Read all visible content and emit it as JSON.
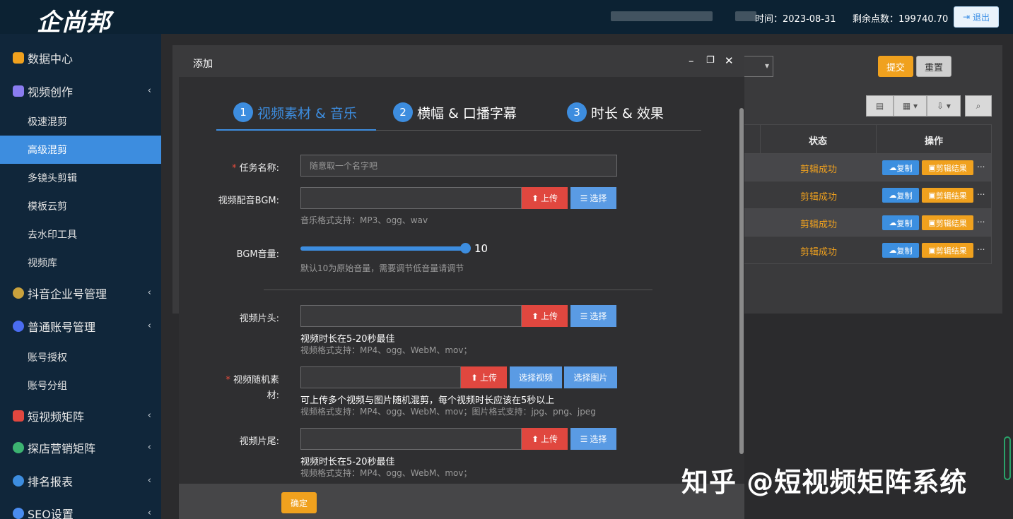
{
  "header": {
    "logo": "企尚邦",
    "time_label": "时间：2023-08-31",
    "points_label": "剩余点数：199740.70",
    "logout": "退出"
  },
  "sidebar": {
    "items": [
      {
        "label": "数据中心",
        "icon": "data-center-icon",
        "color": "#f0a11e"
      },
      {
        "label": "视频创作",
        "icon": "video-create-icon",
        "color": "#8a7cf0"
      },
      {
        "label": "抖音企业号管理",
        "icon": "douyin-icon",
        "color": "#c9a13c"
      },
      {
        "label": "普通账号管理",
        "icon": "account-icon",
        "color": "#4a6cf0"
      },
      {
        "label": "短视频矩阵",
        "icon": "matrix-icon",
        "color": "#e0473f"
      },
      {
        "label": "探店营销矩阵",
        "icon": "store-icon",
        "color": "#3cb371"
      },
      {
        "label": "排名报表",
        "icon": "report-icon",
        "color": "#3d8ddf"
      },
      {
        "label": "SEO设置",
        "icon": "seo-icon",
        "color": "#4a8cf0"
      }
    ],
    "video_subs": [
      "极速混剪",
      "高级混剪",
      "多镜头剪辑",
      "模板云剪",
      "去水印工具",
      "视频库"
    ],
    "account_subs": [
      "账号授权",
      "账号分组"
    ],
    "active_sub": "高级混剪"
  },
  "background": {
    "submit": "提交",
    "reset": "重置",
    "table": {
      "headers": [
        "状态",
        "操作"
      ],
      "rows": [
        {
          "status": "剪辑成功",
          "copy": "复制",
          "result": "剪辑结果",
          "more": "..."
        },
        {
          "status": "剪辑成功",
          "copy": "复制",
          "result": "剪辑结果",
          "more": "..."
        },
        {
          "status": "剪辑成功",
          "copy": "复制",
          "result": "剪辑结果",
          "more": "..."
        },
        {
          "status": "剪辑成功",
          "copy": "复制",
          "result": "剪辑结果",
          "more": "..."
        }
      ]
    }
  },
  "modal": {
    "title": "添加",
    "steps": [
      {
        "num": "1",
        "label": "视频素材 & 音乐"
      },
      {
        "num": "2",
        "label": "横幅 & 口播字幕"
      },
      {
        "num": "3",
        "label": "时长 & 效果"
      }
    ],
    "task_name": {
      "label": "任务名称:",
      "placeholder": "随意取一个名字吧"
    },
    "bgm": {
      "label": "视频配音BGM:",
      "hint": "音乐格式支持：MP3、ogg、wav"
    },
    "volume": {
      "label": "BGM音量:",
      "value": "10",
      "hint": "默认10为原始音量，需要调节低音量请调节"
    },
    "intro": {
      "label": "视频片头:",
      "hint1": "视频时长在5-20秒最佳",
      "hint2": "视频格式支持：MP4、ogg、WebM、mov；"
    },
    "random": {
      "label_1": "视频随机素",
      "label_2": "材:",
      "hint1": "可上传多个视频与图片随机混剪，每个视频时长应该在5秒以上",
      "hint2": "视频格式支持：MP4、ogg、WebM、mov；图片格式支持：jpg、png、jpeg"
    },
    "outro": {
      "label": "视频片尾:",
      "hint1": "视频时长在5-20秒最佳",
      "hint2": "视频格式支持：MP4、ogg、WebM、mov；"
    },
    "upload": "上传",
    "select": "选择",
    "select_video": "选择视频",
    "select_image": "选择图片",
    "confirm": "确定"
  },
  "watermark": "知乎 @短视频矩阵系统"
}
